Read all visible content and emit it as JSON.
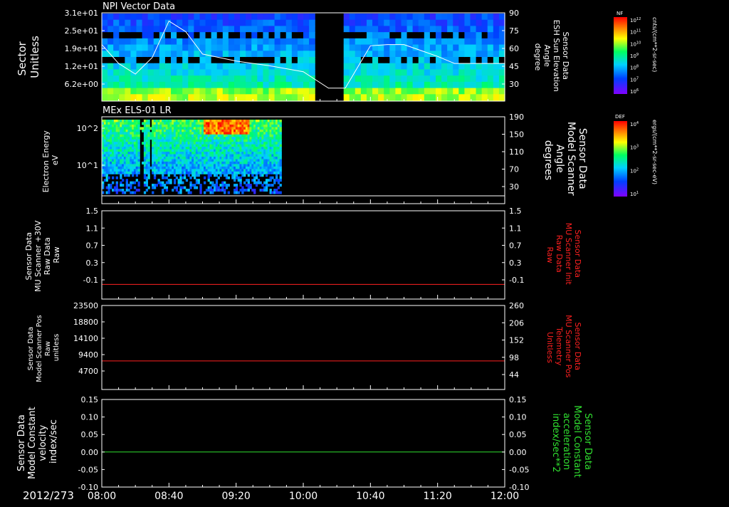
{
  "figure": {
    "date_label": "2012/273"
  },
  "time_axis": {
    "tick_labels": [
      "08:00",
      "08:40",
      "09:20",
      "10:00",
      "10:40",
      "11:20",
      "12:00"
    ]
  },
  "panels": [
    {
      "title": "NPI Vector Data",
      "left_label": [
        "Sector",
        "Unitless"
      ],
      "left_ticks": [
        "3.1e+01",
        "2.5e+01",
        "1.9e+01",
        "1.2e+01",
        "6.2e+00"
      ],
      "right_label": [
        "Sensor Data",
        "ESH Sun Elevation",
        "Angle",
        "degree"
      ],
      "right_ticks": [
        "90",
        "75",
        "60",
        "45",
        "30"
      ],
      "colorbar": {
        "title": "NF",
        "units": "cnts/(cm**2-sr-sec)",
        "tick_labels": [
          "10^12",
          "10^11",
          "10^10",
          "10^9",
          "10^8",
          "10^7",
          "10^6"
        ]
      }
    },
    {
      "title": "MEx ELS-01 LR",
      "left_label": [
        "Electron Energy",
        "eV"
      ],
      "left_ticks": [
        "10^2",
        "10^1"
      ],
      "right_label": [
        "Sensor Data",
        "Model Scanner",
        "Angle",
        "degrees"
      ],
      "right_ticks": [
        "190",
        "150",
        "110",
        "70",
        "30"
      ],
      "colorbar": {
        "title": "DEF",
        "units": "ergs/(cm**2-sr-sec-eV)",
        "tick_labels": [
          "10^4",
          "10^3",
          "10^2",
          "10^1"
        ]
      }
    },
    {
      "left_label": [
        "Sensor Data",
        "MU Scanner +30V",
        "Raw Data",
        "Raw"
      ],
      "left_ticks": [
        "1.5",
        "1.1",
        "0.7",
        "0.3",
        "-0.1"
      ],
      "right_label": [
        "Sensor Data",
        "MU Scanner Init",
        "Raw Data",
        "Raw"
      ],
      "right_ticks": [
        "1.5",
        "1.1",
        "0.7",
        "0.3",
        "-0.1"
      ]
    },
    {
      "left_label": [
        "Sensor Data",
        "Model Scanner Pos",
        "Raw",
        "unitless"
      ],
      "left_ticks": [
        "23500",
        "18800",
        "14100",
        "9400",
        "4700"
      ],
      "right_label": [
        "Sensor Data",
        "MU Scanner Pos",
        "Telemetry",
        "Unitless"
      ],
      "right_ticks": [
        "260",
        "206",
        "152",
        "98",
        "44"
      ]
    },
    {
      "left_label": [
        "Sensor Data",
        "Model Constant",
        "velocity",
        "index/sec"
      ],
      "left_ticks": [
        "0.15",
        "0.10",
        "0.05",
        "0.00",
        "-0.05",
        "-0.10"
      ],
      "right_label": [
        "Sensor Data",
        "Model Constant",
        "acceleration",
        "index/sec**2"
      ],
      "right_ticks": [
        "0.15",
        "0.10",
        "0.05",
        "0.00",
        "-0.05",
        "-0.10"
      ]
    }
  ],
  "colors": {
    "panel3_right_label": "#ff2020",
    "panel4_right_label": "#ff2020",
    "panel5_right_label": "#30e030",
    "red_trace": "#ff2020",
    "green_trace": "#30e030",
    "white_trace": "#ffffff"
  },
  "chart_data": [
    {
      "type": "heatmap",
      "title": "NPI Vector Data",
      "x_range": [
        "08:00",
        "12:00"
      ],
      "y_range": [
        0,
        31
      ],
      "data_gap": [
        "10:08",
        "10:24"
      ],
      "overlay_series": {
        "name": "ESH Sun Elevation Angle",
        "units": "degree",
        "y_range": [
          15,
          90
        ],
        "x": [
          "08:00",
          "08:10",
          "08:20",
          "08:30",
          "08:40",
          "08:50",
          "09:00",
          "09:20",
          "09:40",
          "10:00",
          "10:15",
          "10:25",
          "10:35",
          "10:40",
          "10:50",
          "11:00",
          "11:10",
          "11:20",
          "11:30",
          "12:00"
        ],
        "y": [
          63,
          47,
          38,
          52,
          83,
          74,
          55,
          49,
          45,
          40,
          26,
          26,
          50,
          62,
          63,
          63,
          58,
          53,
          47,
          47
        ]
      }
    },
    {
      "type": "heatmap",
      "title": "MEx ELS-01 LR",
      "x_range": [
        "08:00",
        "09:47"
      ],
      "y_scale": "log",
      "hot_spot_time": [
        "09:00",
        "09:27"
      ],
      "overlay_series": {
        "name": "Model Scanner Angle",
        "y": [
          18
        ]
      }
    },
    {
      "type": "line",
      "series": [
        {
          "name": "MU Scanner +30V Raw Data",
          "x": [
            "08:00",
            "12:00"
          ],
          "y": [
            0.0,
            0.0
          ]
        }
      ],
      "ylim": [
        -0.3,
        1.5
      ]
    },
    {
      "type": "line",
      "series": [
        {
          "name": "Model Scanner Pos Raw",
          "x": [
            "08:00",
            "12:00"
          ],
          "y": [
            8000,
            8000
          ]
        }
      ],
      "ylim": [
        0,
        23500
      ]
    },
    {
      "type": "line",
      "series": [
        {
          "name": "Model Constant velocity",
          "x": [
            "08:00",
            "12:00"
          ],
          "y": [
            0.0,
            0.0
          ]
        }
      ],
      "ylim": [
        -0.1,
        0.15
      ]
    }
  ]
}
